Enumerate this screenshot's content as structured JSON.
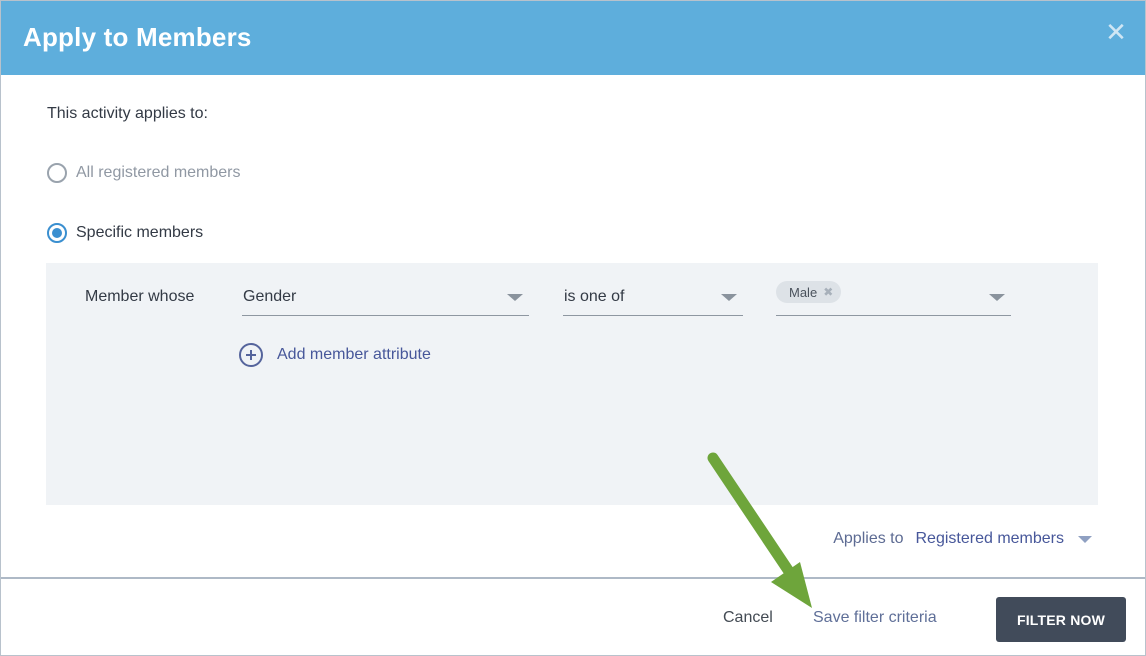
{
  "dialog": {
    "title": "Apply to Members",
    "close_glyph": "✕"
  },
  "intro_text": "This activity applies to:",
  "options": [
    {
      "label": "All registered members",
      "checked": false
    },
    {
      "label": "Specific members",
      "checked": true
    }
  ],
  "filter": {
    "row_label": "Member whose",
    "attribute": "Gender",
    "operator": "is one of",
    "values": [
      "Male"
    ],
    "chip_remove_glyph": "✖",
    "add_attribute_label": "Add member attribute"
  },
  "applies_to": {
    "label": "Applies to",
    "value": "Registered members"
  },
  "footer": {
    "cancel_label": "Cancel",
    "save_label": "Save filter criteria",
    "filter_now_label": "FILTER NOW"
  },
  "colors": {
    "header": "#5eaedc",
    "accent_radio": "#3a8fd0",
    "link": "#47579a",
    "primary_button": "#414b5a",
    "annotation_arrow": "#6ea53b"
  },
  "icons": [
    "close-icon",
    "radio-icon",
    "chevron-down-icon",
    "chip-remove-icon",
    "plus-circle-icon",
    "annotation-arrow"
  ]
}
